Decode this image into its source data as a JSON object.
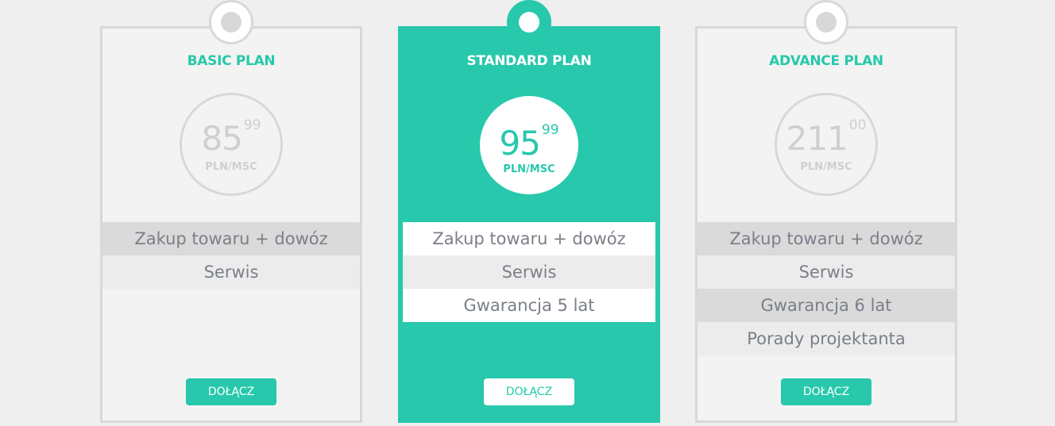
{
  "plans": [
    {
      "title": "BASIC PLAN",
      "price": {
        "whole": "85",
        "cents": "99",
        "unit": "PLN/MSC"
      },
      "features": [
        "Zakup towaru + dowóz",
        "Serwis"
      ],
      "button_label": "DOŁĄCZ"
    },
    {
      "title": "STANDARD PLAN",
      "price": {
        "whole": "95",
        "cents": "99",
        "unit": "PLN/MSC"
      },
      "features": [
        "Zakup towaru + dowóz",
        "Serwis",
        "Gwarancja 5 lat"
      ],
      "button_label": "DOŁĄCZ"
    },
    {
      "title": "ADVANCE PLAN",
      "price": {
        "whole": "211",
        "cents": "00",
        "unit": "PLN/MSC"
      },
      "features": [
        "Zakup towaru + dowóz",
        "Serwis",
        "Gwarancja 6 lat",
        "Porady projektanta"
      ],
      "button_label": "DOŁĄCZ"
    }
  ],
  "colors": {
    "accent": "#27c8ab",
    "card_background": "#f3f3f3",
    "border": "#d8d8d8",
    "feature_text": "#7a7f88",
    "page_background": "#efefef"
  }
}
